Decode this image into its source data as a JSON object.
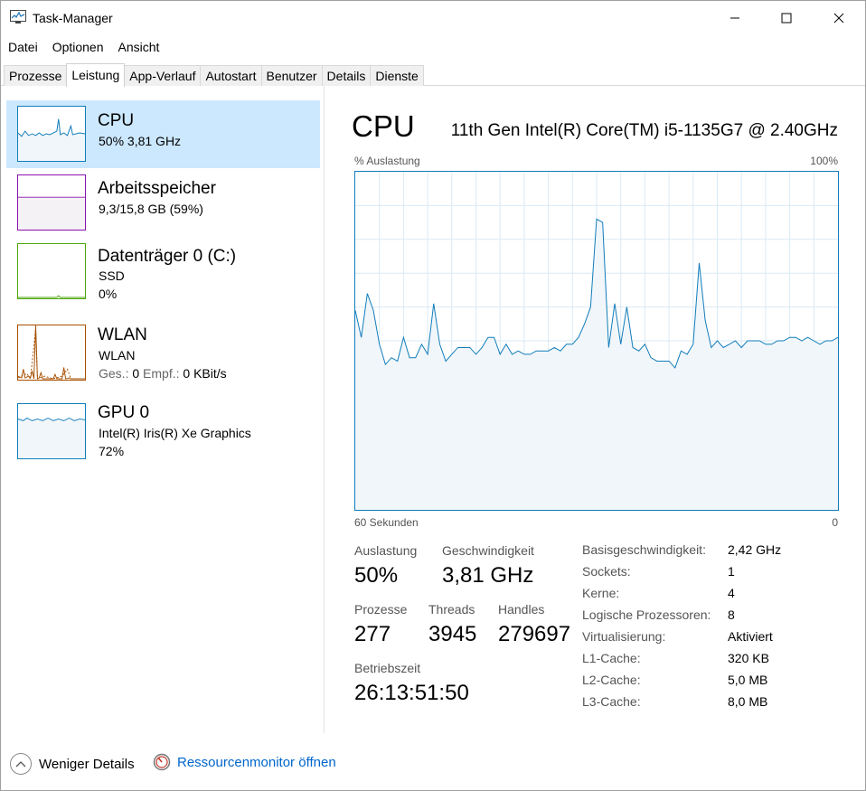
{
  "window": {
    "title": "Task-Manager"
  },
  "menu": [
    "Datei",
    "Optionen",
    "Ansicht"
  ],
  "tabs": [
    "Prozesse",
    "Leistung",
    "App-Verlauf",
    "Autostart",
    "Benutzer",
    "Details",
    "Dienste"
  ],
  "active_tab": "Leistung",
  "sidebar": {
    "items": [
      {
        "title": "CPU",
        "sub1": "50% 3,81 GHz",
        "sub2": "",
        "color": "#117dbb",
        "selected": true
      },
      {
        "title": "Arbeitsspeicher",
        "sub1": "9,3/15,8 GB (59%)",
        "sub2": "",
        "color": "#8b12ae",
        "selected": false
      },
      {
        "title": "Datenträger 0 (C:)",
        "sub1": "SSD",
        "sub2": "0%",
        "color": "#4da60c",
        "selected": false
      },
      {
        "title": "WLAN",
        "sub1": "WLAN",
        "sub2_label_a": "Ges.:",
        "sub2_value_a": "0",
        "sub2_label_b": "Empf.:",
        "sub2_value_b": "0 KBit/s",
        "color": "#a74f01",
        "selected": false
      },
      {
        "title": "GPU 0",
        "sub1": "Intel(R) Iris(R) Xe Graphics",
        "sub2": "72%",
        "color": "#117dbb",
        "selected": false
      }
    ]
  },
  "main": {
    "title": "CPU",
    "model": "11th Gen Intel(R) Core(TM) i5-1135G7 @ 2.40GHz",
    "graph_label_left": "% Auslastung",
    "graph_label_right": "100%",
    "graph_bottom_left": "60 Sekunden",
    "graph_bottom_right": "0",
    "stats": {
      "auslastung_label": "Auslastung",
      "auslastung_value": "50%",
      "geschwindigkeit_label": "Geschwindigkeit",
      "geschwindigkeit_value": "3,81 GHz",
      "prozesse_label": "Prozesse",
      "prozesse_value": "277",
      "threads_label": "Threads",
      "threads_value": "3945",
      "handles_label": "Handles",
      "handles_value": "279697",
      "betriebszeit_label": "Betriebszeit",
      "betriebszeit_value": "26:13:51:50"
    },
    "specs": [
      {
        "label": "Basisgeschwindigkeit:",
        "value": "2,42 GHz"
      },
      {
        "label": "Sockets:",
        "value": "1"
      },
      {
        "label": "Kerne:",
        "value": "4"
      },
      {
        "label": "Logische Prozessoren:",
        "value": "8"
      },
      {
        "label": "Virtualisierung:",
        "value": "Aktiviert"
      },
      {
        "label": "L1-Cache:",
        "value": "320 KB"
      },
      {
        "label": "L2-Cache:",
        "value": "5,0 MB"
      },
      {
        "label": "L3-Cache:",
        "value": "8,0 MB"
      }
    ]
  },
  "chart_data": {
    "type": "area",
    "ylim": [
      0,
      100
    ],
    "x_label_left": "60 Sekunden",
    "x_label_right": "0",
    "values": [
      59,
      51,
      64,
      59,
      49,
      43,
      45,
      44,
      51,
      45,
      45,
      49,
      46,
      61,
      49,
      44,
      46,
      48,
      48,
      48,
      46,
      48,
      51,
      51,
      46,
      49,
      46,
      47,
      46,
      46,
      47,
      47,
      47,
      48,
      47,
      49,
      49,
      51,
      55,
      60,
      86,
      85,
      48,
      61,
      49,
      60,
      48,
      47,
      49,
      45,
      44,
      44,
      44,
      42,
      47,
      46,
      49,
      73,
      56,
      48,
      50,
      48,
      49,
      50,
      48,
      50,
      50,
      50,
      49,
      49,
      50,
      50,
      51,
      51,
      50,
      51,
      50,
      49,
      50,
      50,
      51
    ]
  },
  "footer": {
    "fewer_details": "Weniger Details",
    "resource_monitor": "Ressourcenmonitor öffnen"
  }
}
